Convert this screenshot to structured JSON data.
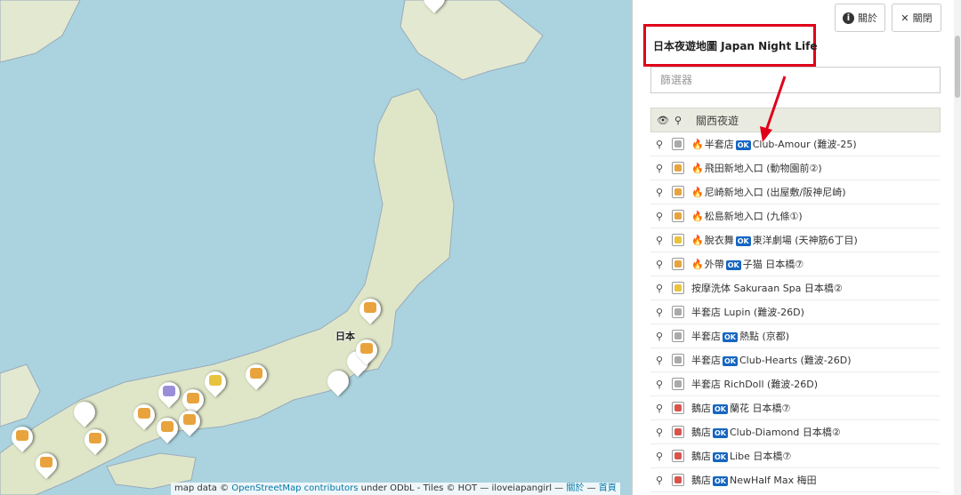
{
  "map": {
    "place_label": "日本",
    "attribution": {
      "prefix": "map data ©",
      "osm_link": "OpenStreetMap contributors",
      "mid": "under ODbL - Tiles © HOT — iloveiapangirl —",
      "about_link": "關於",
      "sep": "—",
      "home_link": "首頁"
    }
  },
  "panel": {
    "title": "日本夜遊地圖 Japan Night Life",
    "about_label": "關於",
    "close_label": "關閉",
    "filter_placeholder": "篩選器",
    "layer_title": "關西夜遊",
    "rows": [
      {
        "flame": "🔥",
        "pre": "半套店",
        "ok": "OK",
        "post": "Club-Amour (難波-25)",
        "color": "#aaaaaa"
      },
      {
        "flame": "🔥",
        "pre": "飛田新地入口 (動物園前②)",
        "ok": "",
        "post": "",
        "color": "#e8a33d"
      },
      {
        "flame": "🔥",
        "pre": "尼崎新地入口 (出屋敷/阪神尼崎)",
        "ok": "",
        "post": "",
        "color": "#e8a33d"
      },
      {
        "flame": "🔥",
        "pre": "松島新地入口 (九條①)",
        "ok": "",
        "post": "",
        "color": "#e8a33d"
      },
      {
        "flame": "🔥",
        "pre": "脫衣舞",
        "ok": "OK",
        "post": "東洋劇場 (天神筋6丁目)",
        "color": "#e8c33d"
      },
      {
        "flame": "🔥",
        "pre": "外帶",
        "ok": "OK",
        "post": "子猫 日本橋⑦",
        "color": "#e8a33d"
      },
      {
        "flame": "",
        "pre": "按摩洗体 Sakuraan Spa 日本橋②",
        "ok": "",
        "post": "",
        "color": "#e8c33d"
      },
      {
        "flame": "",
        "pre": "半套店 Lupin (難波-26D)",
        "ok": "",
        "post": "",
        "color": "#aaaaaa"
      },
      {
        "flame": "",
        "pre": "半套店",
        "ok": "OK",
        "post": "熱點 (京都)",
        "color": "#aaaaaa"
      },
      {
        "flame": "",
        "pre": "半套店",
        "ok": "OK",
        "post": "Club-Hearts (難波-26D)",
        "color": "#aaaaaa"
      },
      {
        "flame": "",
        "pre": "半套店 RichDoll (難波-26D)",
        "ok": "",
        "post": "",
        "color": "#aaaaaa"
      },
      {
        "flame": "",
        "pre": "鵝店",
        "ok": "OK",
        "post": "蘭花 日本橋⑦",
        "color": "#d9534f"
      },
      {
        "flame": "",
        "pre": "鵝店",
        "ok": "OK",
        "post": "Club-Diamond 日本橋②",
        "color": "#d9534f"
      },
      {
        "flame": "",
        "pre": "鵝店",
        "ok": "OK",
        "post": "Libe 日本橋⑦",
        "color": "#d9534f"
      },
      {
        "flame": "",
        "pre": "鵝店",
        "ok": "OK",
        "post": "NewHalf Max 梅田",
        "color": "#d9534f"
      }
    ]
  },
  "colors": {
    "sea": "#aad3df",
    "land": "#e9ecd7",
    "highlight": "#e0001a"
  }
}
